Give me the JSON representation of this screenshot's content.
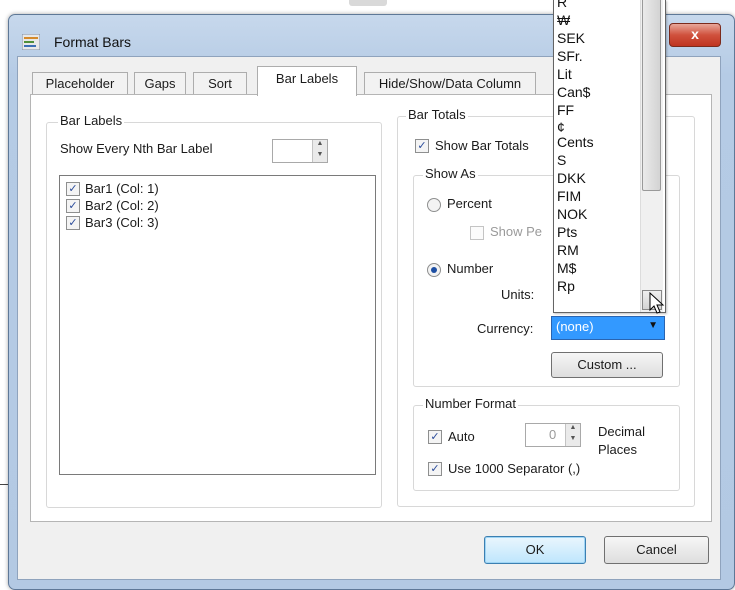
{
  "window": {
    "title": "Format Bars",
    "close_glyph": "x",
    "app_icon": "chart-bars-icon"
  },
  "tabs": [
    {
      "label": "Placeholder",
      "active": false
    },
    {
      "label": "Gaps",
      "active": false
    },
    {
      "label": "Sort",
      "active": false
    },
    {
      "label": "Bar Labels",
      "active": true
    },
    {
      "label": "Hide/Show/Data Column",
      "active": false
    }
  ],
  "bar_labels": {
    "group_title": "Bar Labels",
    "nth_label": "Show Every Nth Bar Label",
    "nth_value": "",
    "items": [
      {
        "label": "Bar1 (Col: 1)",
        "checked": true
      },
      {
        "label": "Bar2 (Col: 2)",
        "checked": true
      },
      {
        "label": "Bar3 (Col: 3)",
        "checked": true
      }
    ]
  },
  "bar_totals": {
    "group_title": "Bar Totals",
    "show_totals_label": "Show Bar Totals",
    "show_totals_checked": true,
    "show_as": {
      "title": "Show As",
      "percent_label": "Percent",
      "percent_selected": false,
      "show_pct_label": "Show Pe",
      "number_label": "Number",
      "number_selected": true,
      "units_label": "Units:",
      "currency_label": "Currency:",
      "currency_value": "(none)",
      "custom_button": "Custom ..."
    }
  },
  "number_format": {
    "group_title": "Number Format",
    "auto_label": "Auto",
    "auto_checked": true,
    "decimal_value": "0",
    "decimal_label_1": "Decimal",
    "decimal_label_2": "Places",
    "separator_label": "Use 1000 Separator (,)",
    "separator_checked": true
  },
  "currency_dropdown": {
    "options": [
      "R",
      "₩",
      "SEK",
      "SFr.",
      "Lit",
      "Can$",
      "FF",
      "¢",
      "Cents",
      "S",
      "DKK",
      "FIM",
      "NOK",
      "Pts",
      "RM",
      "M$",
      "Rp"
    ]
  },
  "footer": {
    "ok": "OK",
    "cancel": "Cancel"
  },
  "colors": {
    "accent": "#3399ff",
    "check": "#2b4c9b",
    "close_button": "#c9422d"
  }
}
